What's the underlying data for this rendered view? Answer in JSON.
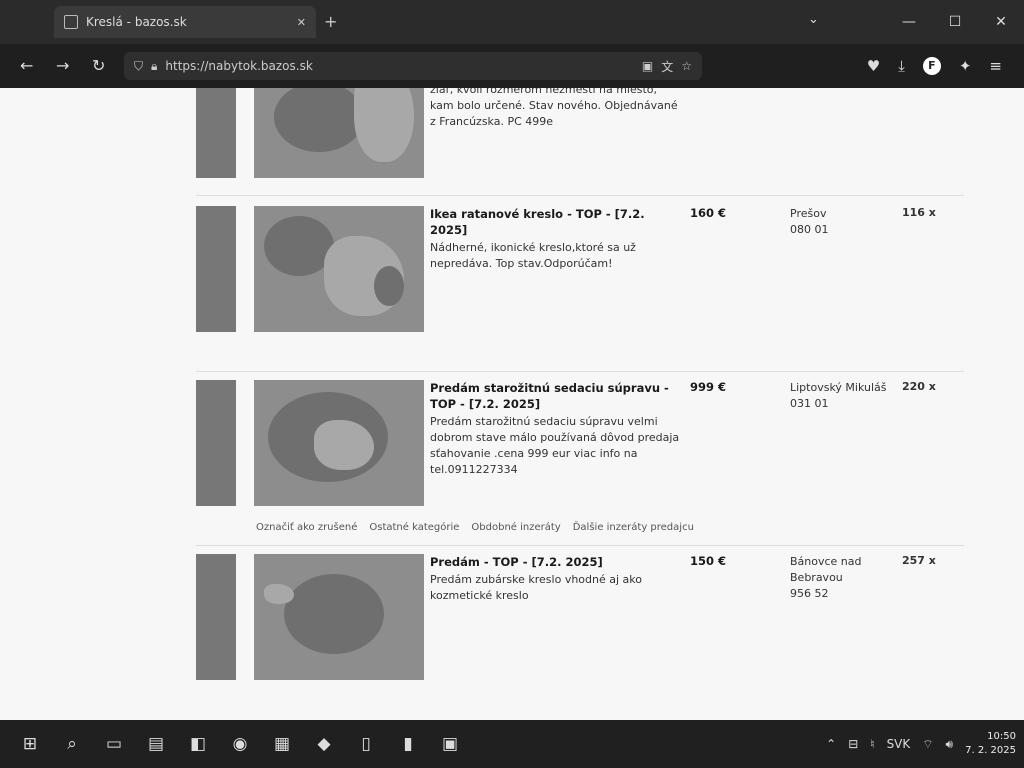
{
  "browser": {
    "tab_title": "Kreslá - bazos.sk",
    "new_tab": "+",
    "tab_list": "⌄",
    "url": "https://nabytok.bazos.sk",
    "window_minimize": "—",
    "window_maximize": "☐",
    "window_close": "✕"
  },
  "listings": [
    {
      "title": "",
      "description": "žiaľ, kvôli rozmerom nezmestí na miesto, kam bolo určené. Stav nového. Objednávané z Francúzska. PC 499e",
      "price": "",
      "location": "",
      "postcode": "",
      "views": ""
    },
    {
      "title": "Ikea ratanové kreslo - TOP - [7.2. 2025]",
      "description": "Nádherné, ikonické kreslo,ktoré sa už nepredáva. Top stav.Odporúčam!",
      "price": "160 €",
      "location": "Prešov",
      "postcode": "080 01",
      "views": "116 x"
    },
    {
      "title": "Predám starožitnú sedaciu súpravu - TOP - [7.2. 2025]",
      "description": "Predám starožitnú sedaciu súpravu velmi dobrom stave málo používaná dôvod predaja sťahovanie .cena 999 eur viac info na tel.0911227334",
      "price": "999 €",
      "location": "Liptovský Mikuláš",
      "postcode": "031 01",
      "views": "220 x"
    },
    {
      "title": "Predám - TOP - [7.2. 2025]",
      "description": "Predám zubárske kreslo vhodné aj ako kozmetické kreslo",
      "price": "150 €",
      "location": "Bánovce nad Bebravou",
      "postcode": "956 52",
      "views": "257 x"
    }
  ],
  "sub_links": [
    "Označiť ako zrušené",
    "Ostatné kategórie",
    "Obdobné inzeráty",
    "Ďalšie inzeráty predajcu"
  ],
  "taskbar": {
    "time": "10:50",
    "date": "7. 2. 2025",
    "lang": "SVK"
  }
}
